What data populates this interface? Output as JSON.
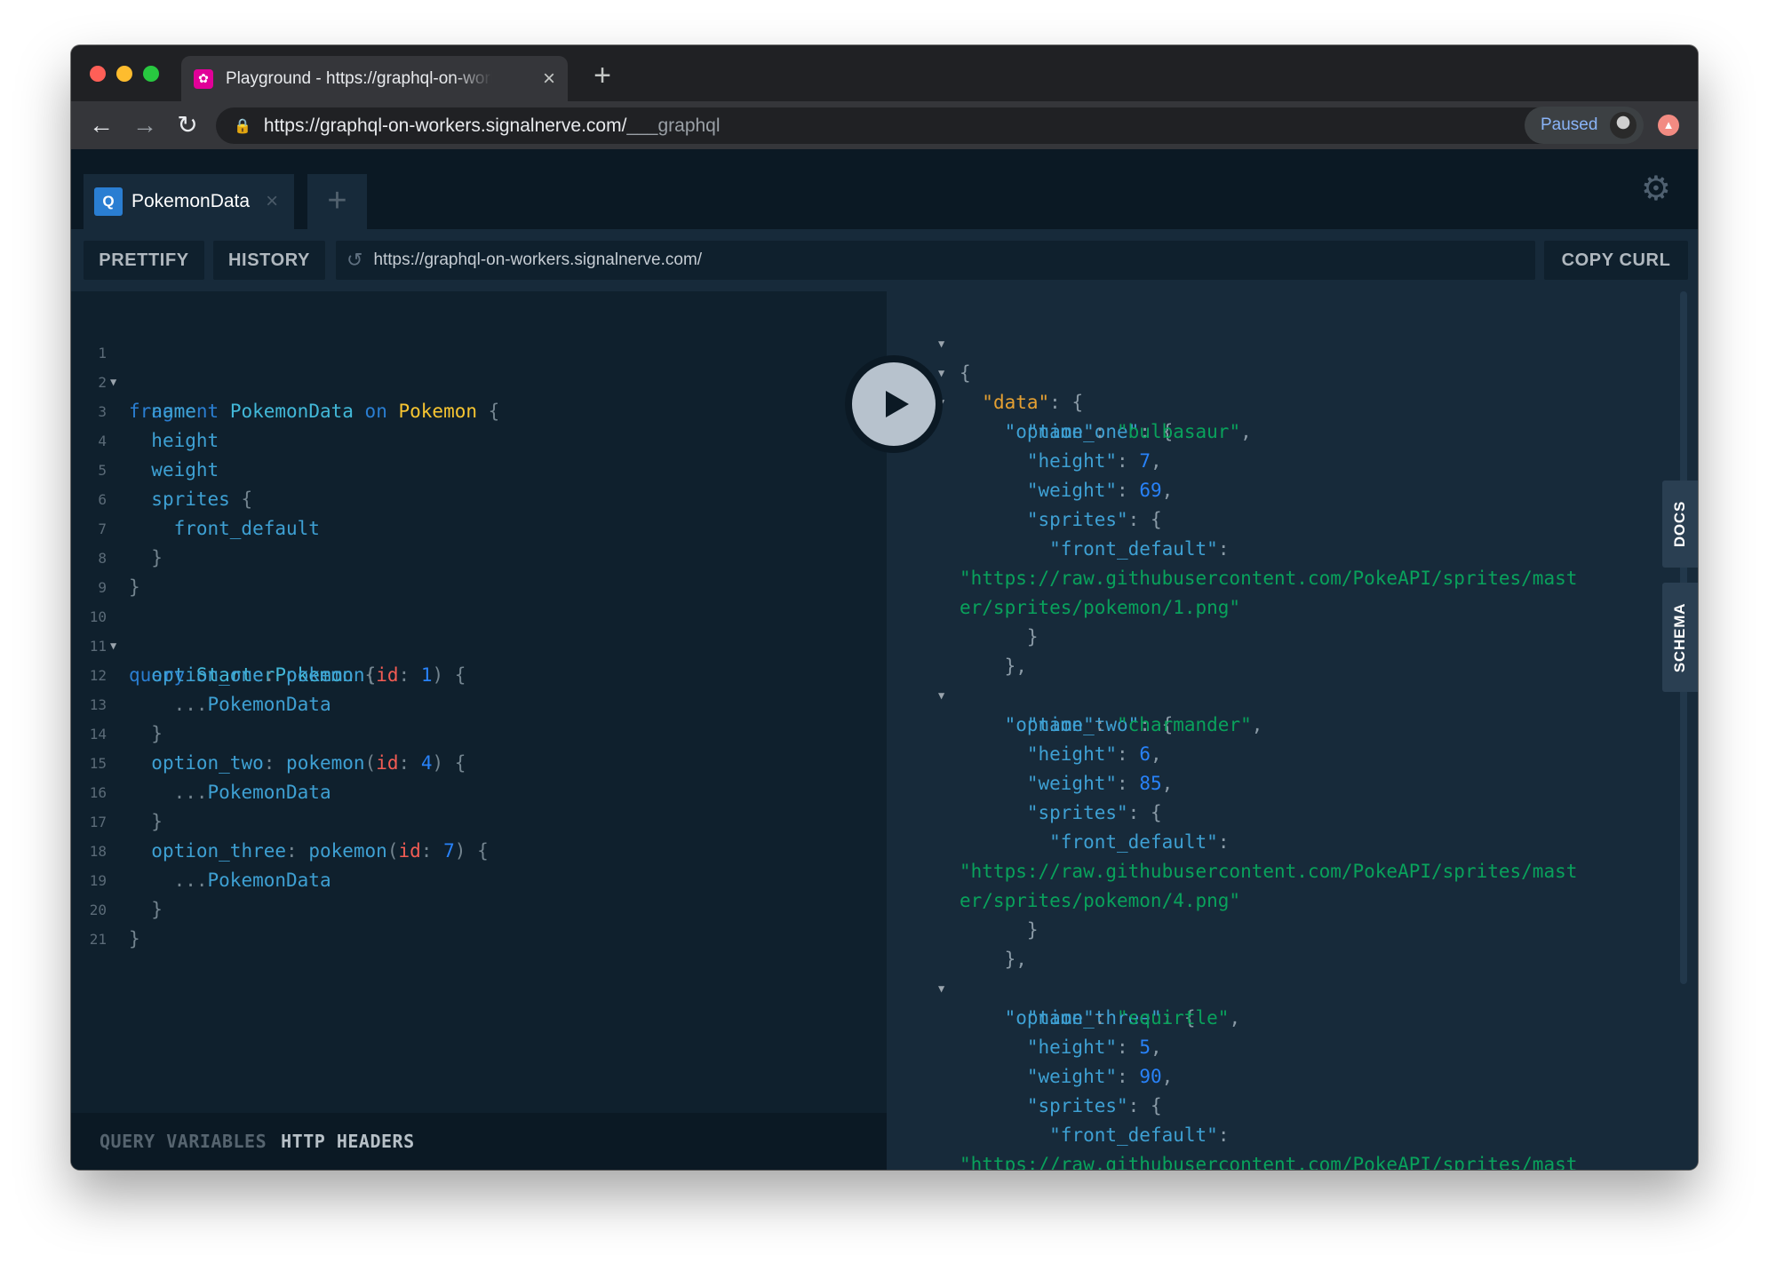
{
  "browser": {
    "tab_title": "Playground - https://graphql-on-workers.signalnerve.com/___graphql",
    "url_main": "https://graphql-on-workers.signalnerve.com/",
    "url_path": "___graphql",
    "profile_label": "Paused"
  },
  "playground": {
    "tab_name": "PokemonData",
    "tab_badge": "Q",
    "toolbar": {
      "prettify": "PRETTIFY",
      "history": "HISTORY",
      "endpoint": "https://graphql-on-workers.signalnerve.com/",
      "copy_curl": "COPY CURL"
    },
    "bottom_tabs": {
      "query_variables": "QUERY VARIABLES",
      "http_headers": "HTTP HEADERS"
    },
    "side_tabs": {
      "docs": "DOCS",
      "schema": "SCHEMA"
    }
  },
  "editor": {
    "line_numbers": [
      "1",
      "2",
      "3",
      "4",
      "5",
      "6",
      "7",
      "8",
      "9",
      "10",
      "11",
      "12",
      "13",
      "14",
      "15",
      "16",
      "17",
      "18",
      "19",
      "20",
      "21"
    ],
    "tokens": {
      "fragment_kw": "fragment",
      "fragment_name": "PokemonData",
      "on_kw": "on",
      "type_name": "Pokemon",
      "open_brace": "{",
      "close_brace": "}",
      "name": "name",
      "height": "height",
      "weight": "weight",
      "sprites": "sprites",
      "front_default": "front_default",
      "query_kw": "query",
      "query_name": "StarterPokemon",
      "option_one": "option_one",
      "option_two": "option_two",
      "option_three": "option_three",
      "pokemon": "pokemon",
      "id_arg": "id",
      "colon": ":",
      "open_paren": "(",
      "close_paren": ")",
      "id_one": "1",
      "id_four": "4",
      "id_seven": "7",
      "spread": "...",
      "spread_name": "PokemonData"
    }
  },
  "result": {
    "data_key": "\"data\"",
    "options": [
      {
        "key": "\"option_one\"",
        "name_value": "\"bulbasaur\"",
        "height": "7",
        "weight": "69",
        "sprite_line1": "\"https://raw.githubusercontent.com/PokeAPI/sprites/mast",
        "sprite_line2": "er/sprites/pokemon/1.png\""
      },
      {
        "key": "\"option_two\"",
        "name_value": "\"charmander\"",
        "height": "6",
        "weight": "85",
        "sprite_line1": "\"https://raw.githubusercontent.com/PokeAPI/sprites/mast",
        "sprite_line2": "er/sprites/pokemon/4.png\""
      },
      {
        "key": "\"option_three\"",
        "name_value": "\"squirtle\"",
        "height": "5",
        "weight": "90",
        "sprite_line1": "\"https://raw.githubusercontent.com/PokeAPI/sprites/mast"
      }
    ],
    "keys": {
      "name": "\"name\"",
      "height": "\"height\"",
      "weight": "\"weight\"",
      "sprites": "\"sprites\"",
      "front_default": "\"front_default\""
    }
  },
  "colors": {
    "keyword": "#2a7ed2",
    "type": "#f7c531",
    "field": "#3ea0d3",
    "argument": "#f25c54",
    "number": "#2882f9",
    "string": "#09a25c",
    "accent_orange": "#e5a032"
  },
  "icons": {
    "favicon": "graphql-icon",
    "back": "arrow-left-icon",
    "forward": "arrow-right-icon",
    "reload": "reload-icon",
    "lock": "lock-icon",
    "bookmark": "star-icon",
    "settings": "gear-icon",
    "run": "play-icon",
    "endpoint_reset": "refresh-icon"
  }
}
